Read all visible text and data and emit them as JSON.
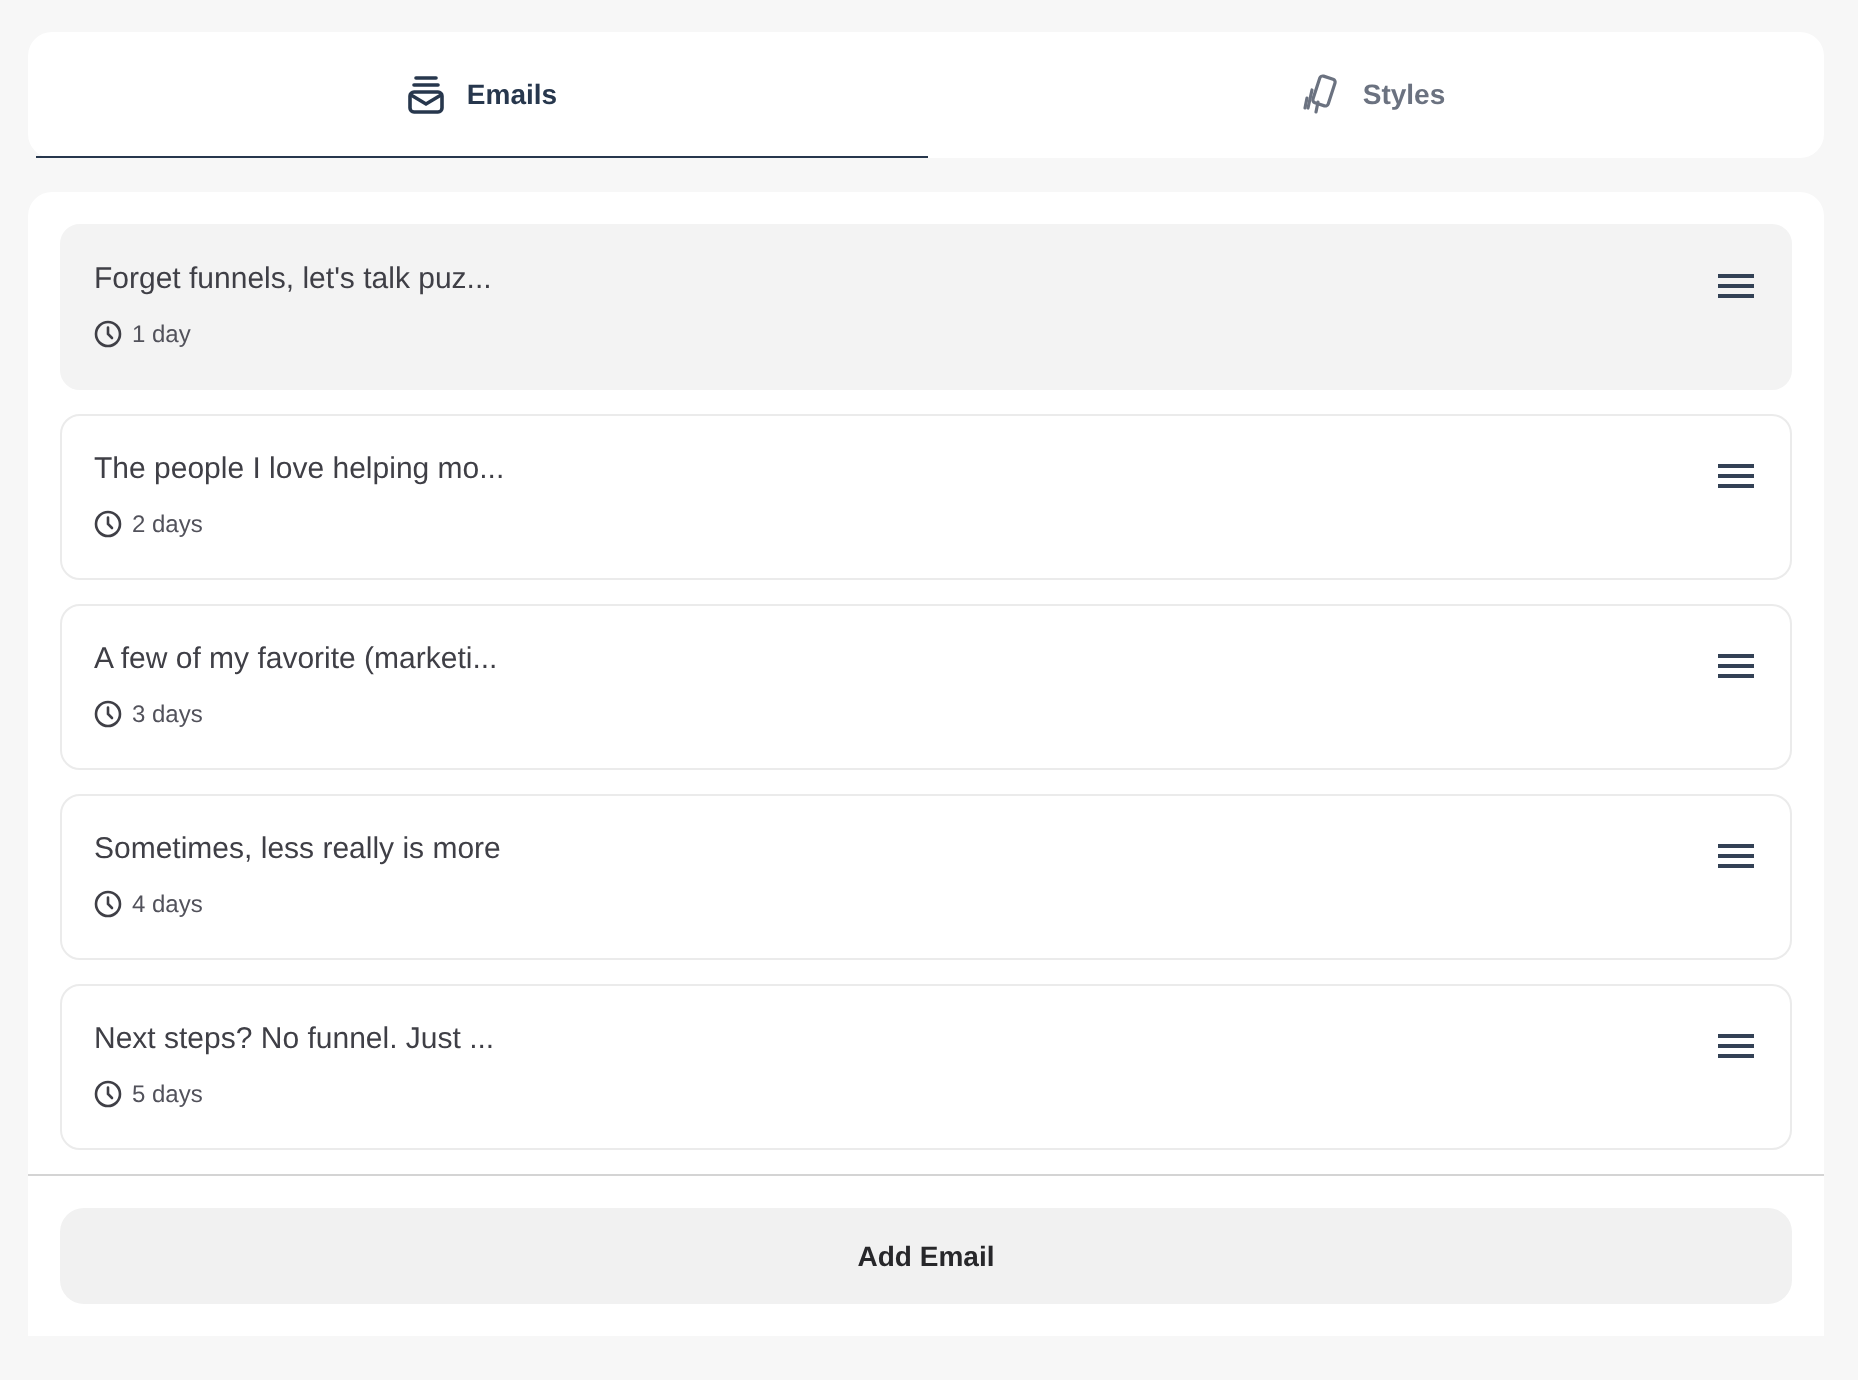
{
  "tabs": [
    {
      "label": "Emails",
      "selected": true
    },
    {
      "label": "Styles",
      "selected": false
    }
  ],
  "emails": [
    {
      "title": "Forget funnels, let's talk puz...",
      "delay": "1 day",
      "selected": true
    },
    {
      "title": "The people I love helping mo...",
      "delay": "2 days",
      "selected": false
    },
    {
      "title": "A few of my favorite (marketi...",
      "delay": "3 days",
      "selected": false
    },
    {
      "title": "Sometimes, less really is more",
      "delay": "4 days",
      "selected": false
    },
    {
      "title": "Next steps? No funnel. Just ...",
      "delay": "5 days",
      "selected": false
    }
  ],
  "add_button": {
    "label": "Add Email"
  }
}
